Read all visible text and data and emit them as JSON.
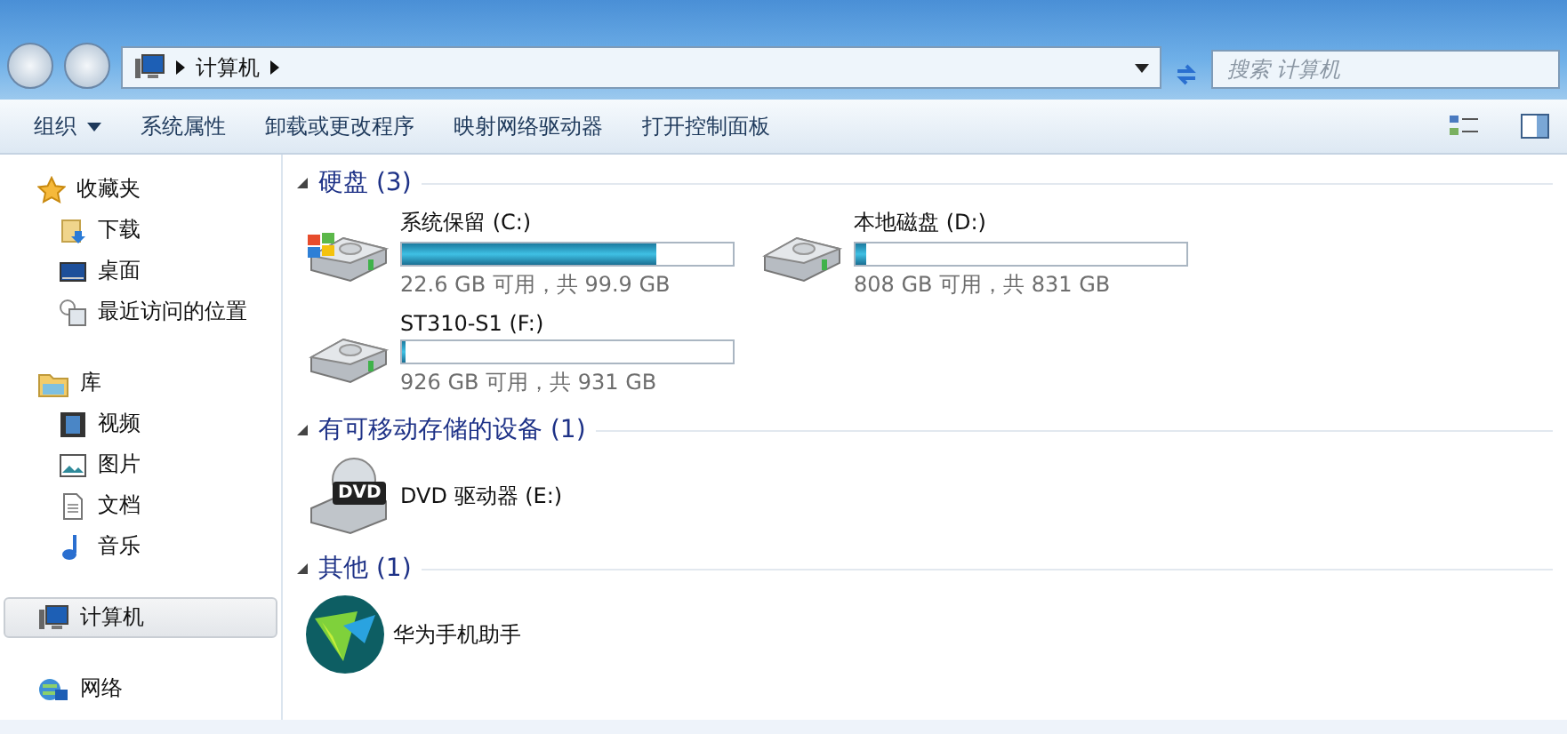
{
  "address": {
    "path": [
      {
        "label": "计算机"
      }
    ],
    "search_placeholder": "搜索 计算机"
  },
  "toolbar": {
    "buttons": [
      {
        "label": "组织",
        "dropdown": true
      },
      {
        "label": "系统属性",
        "dropdown": false
      },
      {
        "label": "卸载或更改程序",
        "dropdown": false
      },
      {
        "label": "映射网络驱动器",
        "dropdown": false
      },
      {
        "label": "打开控制面板",
        "dropdown": false
      }
    ]
  },
  "sidebar": {
    "groups": [
      {
        "label": "收藏夹",
        "kind": "favorites",
        "selected": false,
        "children": [
          {
            "label": "下载",
            "kind": "download"
          },
          {
            "label": "桌面",
            "kind": "desktop"
          },
          {
            "label": "最近访问的位置",
            "kind": "recent"
          }
        ]
      },
      {
        "label": "库",
        "kind": "library",
        "selected": false,
        "children": [
          {
            "label": "视频",
            "kind": "video"
          },
          {
            "label": "图片",
            "kind": "picture"
          },
          {
            "label": "文档",
            "kind": "document"
          },
          {
            "label": "音乐",
            "kind": "music"
          }
        ]
      },
      {
        "label": "计算机",
        "kind": "computer",
        "selected": true
      },
      {
        "label": "网络",
        "kind": "network",
        "selected": false
      }
    ]
  },
  "sections": [
    {
      "title": "硬盘 (3)",
      "expanded": true,
      "items": [
        {
          "kind": "disk",
          "name": "系统保留 (C:)",
          "level": 0.77,
          "system": true,
          "info": "22.6 GB 可用，共 99.9 GB"
        },
        {
          "kind": "disk",
          "name": "本地磁盘 (D:)",
          "level": 0.03,
          "system": false,
          "info": "808 GB 可用，共 831 GB"
        },
        {
          "kind": "disk",
          "name": "ST310-S1 (F:)",
          "level": 0.01,
          "system": false,
          "info": "926 GB 可用，共 931 GB"
        }
      ]
    },
    {
      "title": "有可移动存储的设备 (1)",
      "expanded": true,
      "items": [
        {
          "kind": "dvd",
          "name": "DVD 驱动器 (E:)",
          "badge": "DVD"
        }
      ]
    },
    {
      "title": "其他 (1)",
      "expanded": true,
      "items": [
        {
          "kind": "app",
          "name": "华为手机助手"
        }
      ]
    }
  ]
}
